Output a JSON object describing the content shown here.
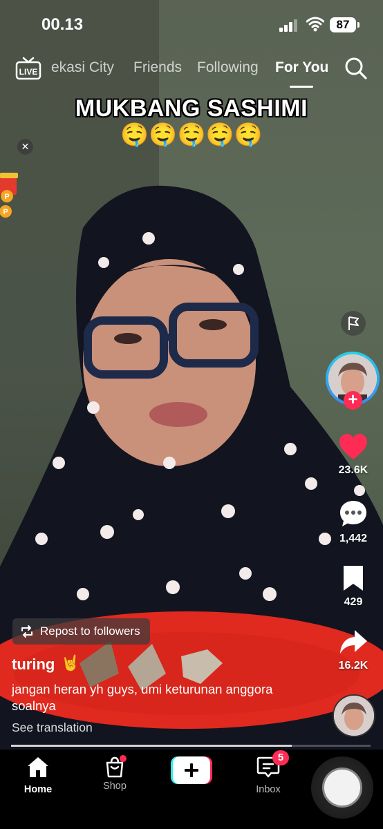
{
  "status_bar": {
    "time": "00.13",
    "battery": "87"
  },
  "top_nav": {
    "live_label": "LIVE",
    "tabs": [
      {
        "label": "ekasi City"
      },
      {
        "label": "Friends"
      },
      {
        "label": "Following"
      },
      {
        "label": "For You"
      }
    ],
    "active_tab": "For You"
  },
  "video": {
    "caption_title": "MUKBANG SASHIMI",
    "caption_emoji": "🤤🤤🤤🤤🤤"
  },
  "actions": {
    "likes": "23.6K",
    "comments": "1,442",
    "saves": "429",
    "shares": "16.2K"
  },
  "post": {
    "repost_label": "Repost to followers",
    "username": "turing",
    "username_emoji": "🤘",
    "description": "jangan heran yh guys, umi keturunan anggora soalnya",
    "see_translation": "See translation",
    "progress": 0.78
  },
  "tab_bar": {
    "home": "Home",
    "shop": "Shop",
    "inbox": "Inbox",
    "inbox_badge": "5"
  },
  "colors": {
    "accent": "#fe2c55",
    "ring": "#29d3e6",
    "like": "#fe2c55"
  }
}
